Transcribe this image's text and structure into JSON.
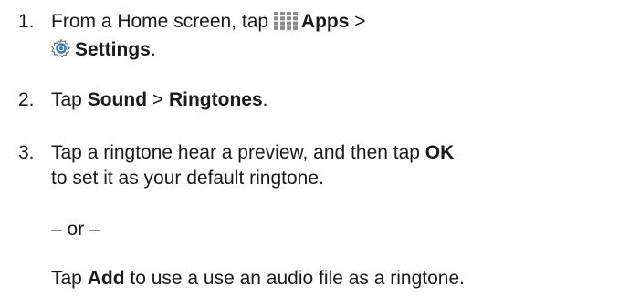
{
  "steps": [
    {
      "number": "1.",
      "line1_prefix": "From a Home screen, tap ",
      "apps_icon": "apps-grid-icon",
      "apps_label": "Apps",
      "sep": " >",
      "settings_icon": "settings-gear-icon",
      "settings_label": "Settings",
      "end": "."
    },
    {
      "number": "2.",
      "prefix": "Tap ",
      "sound": "Sound",
      "sep": " > ",
      "ringtones": "Ringtones",
      "end": "."
    },
    {
      "number": "3.",
      "line1_prefix": "Tap a ringtone hear a preview, and then tap ",
      "ok": "OK",
      "line2": "to set it as your default ringtone.",
      "or_text": "– or –",
      "alt_prefix": "Tap ",
      "add": "Add",
      "alt_suffix": " to use a use an audio file as a ringtone."
    }
  ],
  "colors": {
    "text": "#1a1a1a",
    "apps_icon": "#8a8a8a",
    "settings_icon": "#2a7fc4"
  }
}
